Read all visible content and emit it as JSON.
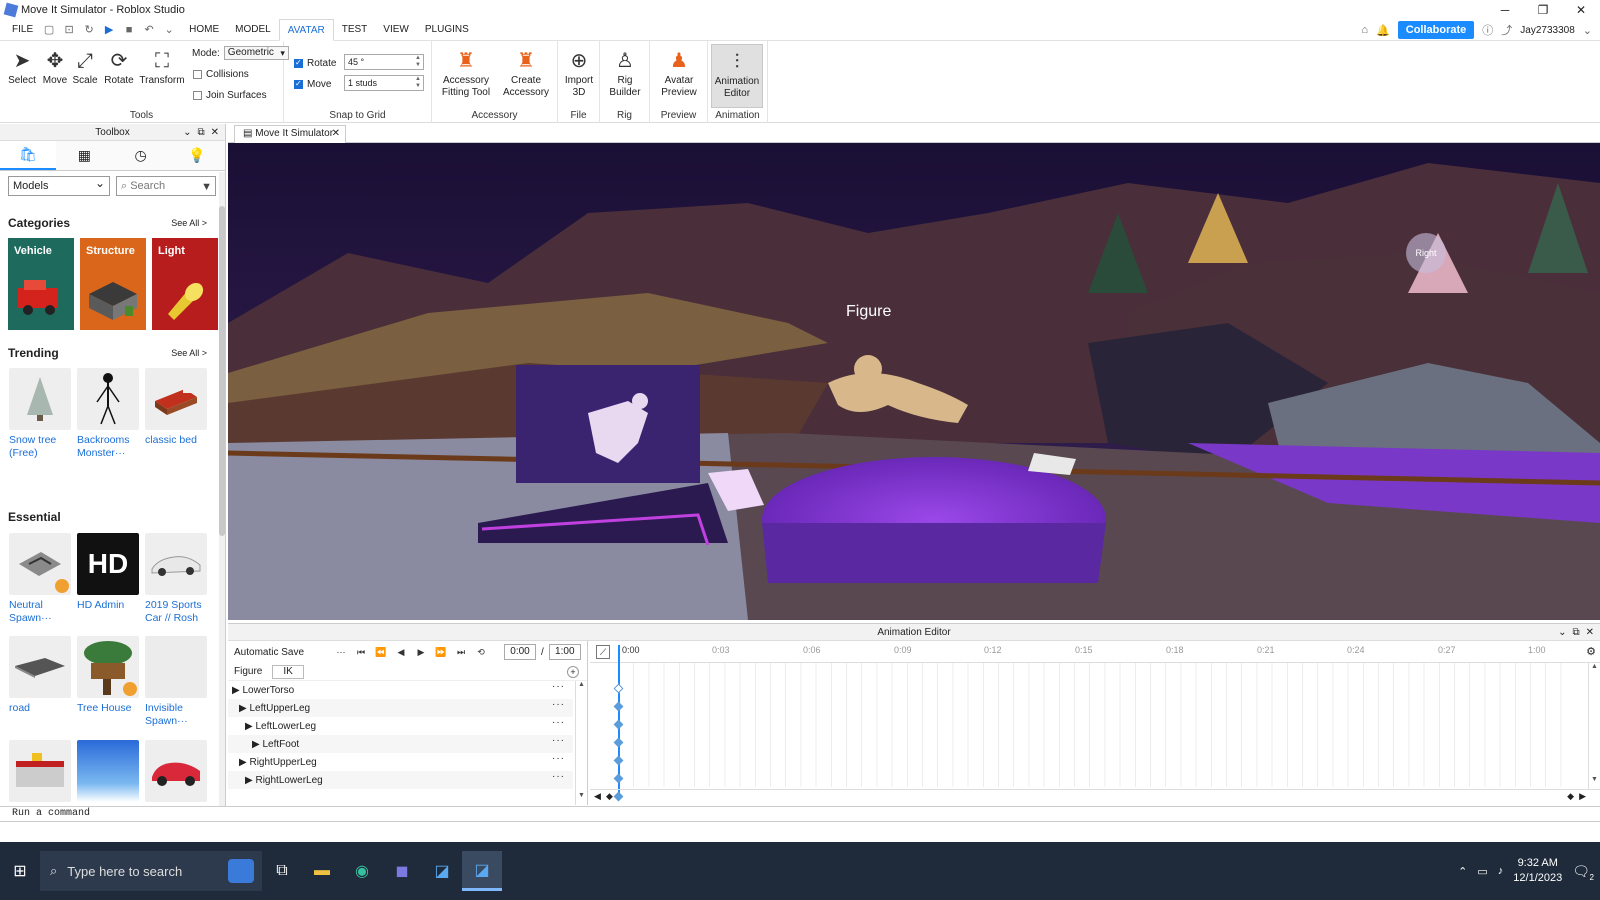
{
  "window": {
    "title": "Move It Simulator - Roblox Studio",
    "minimize": "─",
    "restore": "❐",
    "close": "✕"
  },
  "menu": {
    "items": [
      "FILE",
      "HOME",
      "MODEL",
      "AVATAR",
      "TEST",
      "VIEW",
      "PLUGINS"
    ],
    "active": "AVATAR"
  },
  "account": {
    "collaborate": "Collaborate",
    "username": "Jay2733308"
  },
  "ribbon": {
    "tools": {
      "label": "Tools",
      "select": "Select",
      "move": "Move",
      "scale": "Scale",
      "rotate": "Rotate",
      "transform": "Transform",
      "mode_label": "Mode:",
      "mode_value": "Geometric",
      "collisions": "Collisions",
      "join_surfaces": "Join Surfaces"
    },
    "snap": {
      "label": "Snap to Grid",
      "rotate": "Rotate",
      "rotate_value": "45 °",
      "move": "Move",
      "move_value": "1 studs"
    },
    "accessory": {
      "label": "Accessory",
      "fitting_1": "Accessory",
      "fitting_2": "Fitting Tool",
      "create_1": "Create",
      "create_2": "Accessory"
    },
    "file": {
      "label": "File",
      "import_1": "Import",
      "import_2": "3D"
    },
    "rig": {
      "label": "Rig",
      "builder_1": "Rig",
      "builder_2": "Builder"
    },
    "preview": {
      "label": "Preview",
      "avatar_1": "Avatar",
      "avatar_2": "Preview"
    },
    "animation": {
      "label": "Animation",
      "editor_1": "Animation",
      "editor_2": "Editor"
    }
  },
  "toolbox": {
    "title": "Toolbox",
    "filter": "Models",
    "search_placeholder": "Search",
    "categories_title": "Categories",
    "see_all": "See All >",
    "categories": [
      {
        "name": "Vehicle",
        "color": "#1e6b5e"
      },
      {
        "name": "Structure",
        "color": "#d9661a"
      },
      {
        "name": "Light",
        "color": "#b81d1d"
      }
    ],
    "trending_title": "Trending",
    "trending": [
      {
        "line1": "Snow tree",
        "line2": "(Free)"
      },
      {
        "line1": "Backrooms",
        "line2": "Monster···"
      },
      {
        "line1": "classic bed",
        "line2": ""
      }
    ],
    "essential_title": "Essential",
    "essential": [
      {
        "line1": "Neutral",
        "line2": "Spawn···"
      },
      {
        "line1": "HD Admin",
        "line2": ""
      },
      {
        "line1": "2019 Sports",
        "line2": "Car // Rosh"
      },
      {
        "line1": "road",
        "line2": ""
      },
      {
        "line1": "Tree House",
        "line2": ""
      },
      {
        "line1": "Invisible",
        "line2": "Spawn···"
      }
    ],
    "hd_admin_logo": "HD"
  },
  "document_tab": "Move It Simulator",
  "viewport": {
    "figure_label": "Figure",
    "view_cube_label": "Right"
  },
  "animation_editor": {
    "title": "Animation Editor",
    "autosave": "Automatic Save",
    "current_time": "0:00",
    "separator": "/",
    "end_time": "1:00",
    "rig_name": "Figure",
    "ik_label": "IK",
    "tracks": [
      "LowerTorso",
      "LeftUpperLeg",
      "LeftLowerLeg",
      "LeftFoot",
      "RightUpperLeg",
      "RightLowerLeg"
    ],
    "ruler": [
      "0:00",
      "0:03",
      "0:06",
      "0:09",
      "0:12",
      "0:15",
      "0:18",
      "0:21",
      "0:24",
      "0:27",
      "1:00"
    ]
  },
  "command_bar": {
    "placeholder": "Run a command"
  },
  "taskbar": {
    "search_placeholder": "Type here to search",
    "time": "9:32 AM",
    "date": "12/1/2023",
    "notifications": "2"
  }
}
